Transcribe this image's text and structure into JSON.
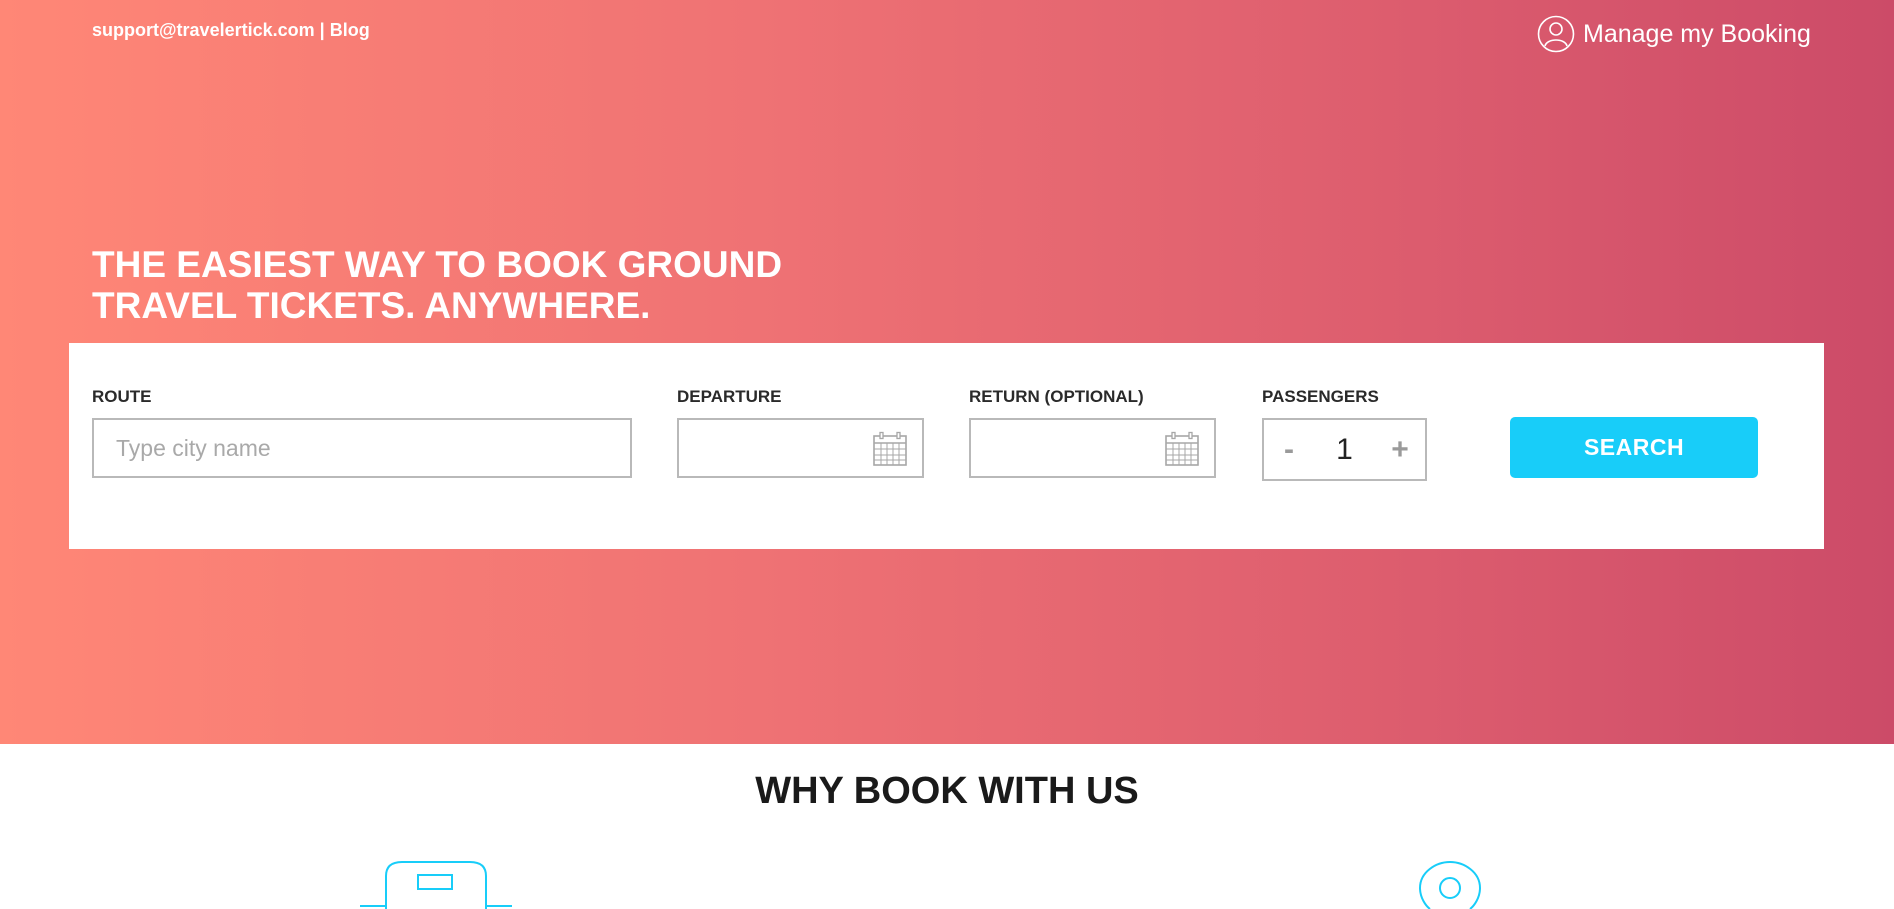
{
  "header": {
    "support_email": "support@travelertick.com",
    "separator": "|",
    "blog_link": "Blog",
    "manage_booking": "Manage my Booking"
  },
  "hero": {
    "headline_line1": "THE EASIEST WAY TO BOOK GROUND",
    "headline_line2": "TRAVEL TICKETS. ANYWHERE."
  },
  "search": {
    "route_label": "ROUTE",
    "route_placeholder": "Type city name",
    "route_value": "",
    "departure_label": "DEPARTURE",
    "departure_value": "",
    "return_label": "RETURN (OPTIONAL)",
    "return_value": "",
    "passengers_label": "PASSENGERS",
    "passengers_minus": "-",
    "passengers_value": "1",
    "passengers_plus": "+",
    "search_button": "SEARCH"
  },
  "why_section": {
    "title": "WHY BOOK WITH US",
    "feature_icons": [
      "luggage-icon",
      "location-pin-icon"
    ]
  },
  "colors": {
    "gradient_start": "#ff8776",
    "gradient_end": "#cc4b68",
    "accent": "#18cdf9",
    "input_border": "#b9b9b9"
  },
  "icons": {
    "manage_booking": "user-circle-icon",
    "date_picker": "calendar-icon"
  }
}
